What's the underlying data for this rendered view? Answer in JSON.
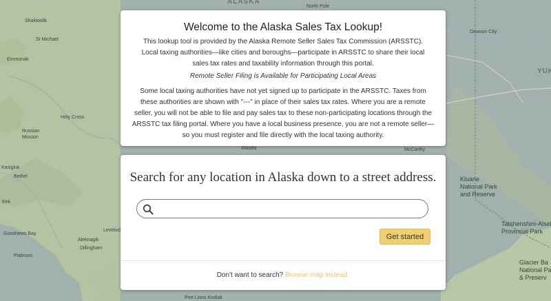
{
  "map": {
    "labels": {
      "alaska": "ALASKA",
      "north_pole": "North Pole",
      "shaktoolik": "Shaktoolik",
      "st_michael": "St Michael",
      "emmonak": "Emmonak",
      "holy_cross": "Holy Cross",
      "russian_mission": "Russian Mission",
      "bethel": "Bethel",
      "kasigluk": "Kasigluk",
      "eek": "Eek",
      "goodnews_bay": "Goodnews Bay",
      "platinum": "Platinum",
      "dillingham": "Dillingham",
      "aleknagik": "Aleknagik",
      "levelock": "Levelock",
      "dawson_city": "Dawson City",
      "yukon": "YUK",
      "mccarthy": "McCarthy",
      "wasilla": "Wasilla",
      "kluane": "Kluane National Park and Reserve",
      "tatshenshini": "Tatshenshini-Alsek Provincial Park",
      "glacier_bay": "Glacier Ba National Park & Preserv",
      "port_lions": "Port Lions  Kodiak"
    }
  },
  "welcome": {
    "title": "Welcome to the Alaska Sales Tax Lookup!",
    "intro": "This lookup tool is provided by the Alaska Remote Seller Sales Tax Commission (ARSSTC).  Local taxing authorities—like cities and boroughs—participate in ARSSTC to share their local sales tax rates and taxability information through this portal.",
    "notice": "Remote Seller Filing is Available for Participating Local Areas",
    "details": "Some local taxing authorities have not yet signed up to participate in the ARSSTC. Taxes from these authorities are shown with \"---\" in place of their sales tax rates. Where you are a remote seller, you will not be able to file and pay sales tax to these non-participating locations through the ARSSTC tax filing portal. Where you have a local business presence, you are not a remote seller—so you must register and file directly with the local taxing authority."
  },
  "search": {
    "heading": "Search for any location in Alaska down to a street address.",
    "placeholder": "",
    "value": "",
    "button_label": "Get started",
    "footer_text": "Don't want to search?",
    "footer_link": "Browse map instead."
  },
  "colors": {
    "accent_button": "#f2cf6e",
    "link": "#f0c46a",
    "map_water": "#98a7a5",
    "map_land": "#b9c9a8"
  },
  "icons": {
    "search": "search-icon"
  }
}
